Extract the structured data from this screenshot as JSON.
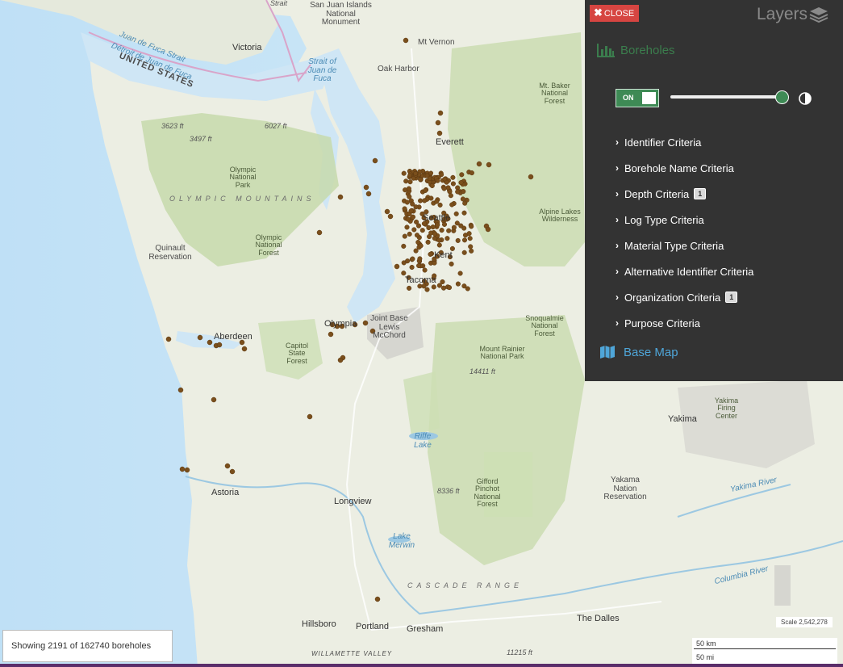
{
  "panel": {
    "close_label": "CLOSE",
    "title": "Layers",
    "layer_name": "Boreholes",
    "toggle_label": "ON",
    "opacity": 1.0,
    "criteria": [
      {
        "label": "Identifier Criteria",
        "badge": ""
      },
      {
        "label": "Borehole Name Criteria",
        "badge": ""
      },
      {
        "label": "Depth Criteria",
        "badge": "1"
      },
      {
        "label": "Log Type Criteria",
        "badge": ""
      },
      {
        "label": "Material Type Criteria",
        "badge": ""
      },
      {
        "label": "Alternative Identifier Criteria",
        "badge": ""
      },
      {
        "label": "Organization Criteria",
        "badge": "1"
      },
      {
        "label": "Purpose Criteria",
        "badge": ""
      }
    ],
    "basemap_label": "Base Map"
  },
  "status": {
    "text": "Showing 2191 of 162740 boreholes"
  },
  "scale": {
    "text": "Scale 2,542,278",
    "km": "50 km",
    "mi": "50 mi"
  },
  "map": {
    "labels": {
      "strait": "Strait",
      "san_juan_islands": "San Juan Islands National Monument",
      "victoria": "Victoria",
      "mt_vernon": "Mt Vernon",
      "oak_harbor": "Oak Harbor",
      "strait_juan_de_fuca": "Strait of Juan de Fuca",
      "juan_de_fuca_strait": "Juan de Fuca Strait",
      "detroit_juan_de_fuca": "Détroit de Juan de Fuca",
      "united_states": "UNITED STATES",
      "mt_baker": "Mt. Baker National Forest",
      "everett": "Everett",
      "elev_3623": "3623 ft",
      "elev_3497": "3497 ft",
      "elev_6027": "6027 ft",
      "olympic_np": "Olympic National Park",
      "olympic_mountains": "OLYMPIC MOUNTAINS",
      "alpine_lakes": "Alpine Lakes Wilderness",
      "seattle": "Seattle",
      "olympic_nf": "Olympic National Forest",
      "quinault": "Quinault Reservation",
      "kent": "Kent",
      "tacoma": "Tacoma",
      "olympia": "Olympia",
      "jblm": "Joint Base Lewis McChord",
      "aberdeen": "Aberdeen",
      "snoqualmie": "Snoqualmie National Forest",
      "capitol": "Capitol State Forest",
      "rainier": "Mount Rainier National Park",
      "elev_14411": "14411 ft",
      "yakima_firing": "Yakima Firing Center",
      "yakima": "Yakima",
      "riffe": "Riffe Lake",
      "astoria": "Astoria",
      "gifford": "Gifford Pinchot National Forest",
      "elev_8336": "8336 ft",
      "yakama_nation": "Yakama Nation Reservation",
      "yakima_river": "Yakima River",
      "longview": "Longview",
      "lake_merwin": "Lake Merwin",
      "cascade_range": "CASCADE RANGE",
      "columbia": "Columbia River",
      "hillsboro": "Hillsboro",
      "portland": "Portland",
      "gresham": "Gresham",
      "the_dalles": "The Dalles",
      "willamette": "WILLAMETTE VALLEY",
      "elev_11215": "11215 ft"
    }
  },
  "colors": {
    "panel_bg": "#333333",
    "close_red": "#d64541",
    "layer_green": "#3b7d4d",
    "basemap_blue": "#4fa6d9",
    "borehole_brown": "#7a4f1c",
    "water": "#cfe6f5"
  }
}
